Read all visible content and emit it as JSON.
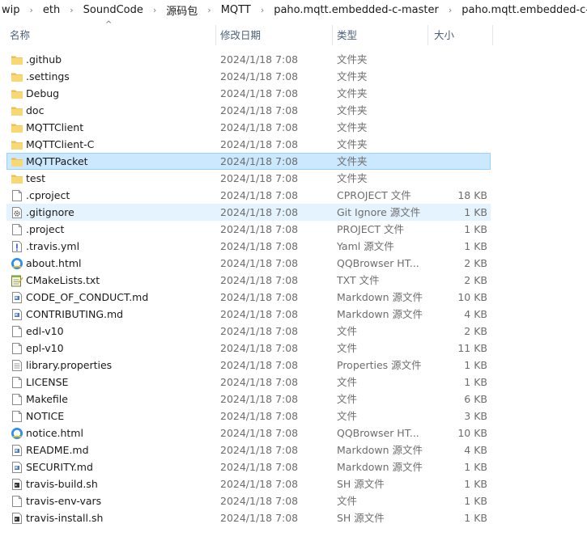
{
  "breadcrumb": [
    "wip",
    "eth",
    "SoundCode",
    "源码包",
    "MQTT",
    "paho.mqtt.embedded-c-master",
    "paho.mqtt.embedded-c-master"
  ],
  "columns": {
    "name": "名称",
    "date": "修改日期",
    "type": "类型",
    "size": "大小"
  },
  "files": [
    {
      "name": ".github",
      "date": "2024/1/18 7:08",
      "type": "文件夹",
      "size": "",
      "icon": "folder-icon"
    },
    {
      "name": ".settings",
      "date": "2024/1/18 7:08",
      "type": "文件夹",
      "size": "",
      "icon": "folder-icon"
    },
    {
      "name": "Debug",
      "date": "2024/1/18 7:08",
      "type": "文件夹",
      "size": "",
      "icon": "folder-icon"
    },
    {
      "name": "doc",
      "date": "2024/1/18 7:08",
      "type": "文件夹",
      "size": "",
      "icon": "folder-icon"
    },
    {
      "name": "MQTTClient",
      "date": "2024/1/18 7:08",
      "type": "文件夹",
      "size": "",
      "icon": "folder-icon"
    },
    {
      "name": "MQTTClient-C",
      "date": "2024/1/18 7:08",
      "type": "文件夹",
      "size": "",
      "icon": "folder-icon"
    },
    {
      "name": "MQTTPacket",
      "date": "2024/1/18 7:08",
      "type": "文件夹",
      "size": "",
      "icon": "folder-icon",
      "selected": true
    },
    {
      "name": "test",
      "date": "2024/1/18 7:08",
      "type": "文件夹",
      "size": "",
      "icon": "folder-icon"
    },
    {
      "name": ".cproject",
      "date": "2024/1/18 7:08",
      "type": "CPROJECT 文件",
      "size": "18 KB",
      "icon": "file-icon"
    },
    {
      "name": ".gitignore",
      "date": "2024/1/18 7:08",
      "type": "Git Ignore 源文件",
      "size": "1 KB",
      "icon": "gear-file-icon",
      "hover": true
    },
    {
      "name": ".project",
      "date": "2024/1/18 7:08",
      "type": "PROJECT 文件",
      "size": "1 KB",
      "icon": "file-icon"
    },
    {
      "name": ".travis.yml",
      "date": "2024/1/18 7:08",
      "type": "Yaml 源文件",
      "size": "1 KB",
      "icon": "exclamation-file-icon"
    },
    {
      "name": "about.html",
      "date": "2024/1/18 7:08",
      "type": "QQBrowser HT...",
      "size": "2 KB",
      "icon": "browser-icon"
    },
    {
      "name": "CMakeLists.txt",
      "date": "2024/1/18 7:08",
      "type": "TXT 文件",
      "size": "2 KB",
      "icon": "notepad-icon"
    },
    {
      "name": "CODE_OF_CONDUCT.md",
      "date": "2024/1/18 7:08",
      "type": "Markdown 源文件",
      "size": "10 KB",
      "icon": "markdown-file-icon"
    },
    {
      "name": "CONTRIBUTING.md",
      "date": "2024/1/18 7:08",
      "type": "Markdown 源文件",
      "size": "4 KB",
      "icon": "markdown-file-icon"
    },
    {
      "name": "edl-v10",
      "date": "2024/1/18 7:08",
      "type": "文件",
      "size": "2 KB",
      "icon": "file-icon"
    },
    {
      "name": "epl-v10",
      "date": "2024/1/18 7:08",
      "type": "文件",
      "size": "11 KB",
      "icon": "file-icon"
    },
    {
      "name": "library.properties",
      "date": "2024/1/18 7:08",
      "type": "Properties 源文件",
      "size": "1 KB",
      "icon": "text-file-icon"
    },
    {
      "name": "LICENSE",
      "date": "2024/1/18 7:08",
      "type": "文件",
      "size": "1 KB",
      "icon": "file-icon"
    },
    {
      "name": "Makefile",
      "date": "2024/1/18 7:08",
      "type": "文件",
      "size": "6 KB",
      "icon": "file-icon"
    },
    {
      "name": "NOTICE",
      "date": "2024/1/18 7:08",
      "type": "文件",
      "size": "3 KB",
      "icon": "file-icon"
    },
    {
      "name": "notice.html",
      "date": "2024/1/18 7:08",
      "type": "QQBrowser HT...",
      "size": "10 KB",
      "icon": "browser-icon"
    },
    {
      "name": "README.md",
      "date": "2024/1/18 7:08",
      "type": "Markdown 源文件",
      "size": "4 KB",
      "icon": "markdown-file-icon"
    },
    {
      "name": "SECURITY.md",
      "date": "2024/1/18 7:08",
      "type": "Markdown 源文件",
      "size": "1 KB",
      "icon": "markdown-file-icon"
    },
    {
      "name": "travis-build.sh",
      "date": "2024/1/18 7:08",
      "type": "SH 源文件",
      "size": "1 KB",
      "icon": "shell-file-icon"
    },
    {
      "name": "travis-env-vars",
      "date": "2024/1/18 7:08",
      "type": "文件",
      "size": "1 KB",
      "icon": "file-icon"
    },
    {
      "name": "travis-install.sh",
      "date": "2024/1/18 7:08",
      "type": "SH 源文件",
      "size": "1 KB",
      "icon": "shell-file-icon"
    }
  ],
  "colors": {
    "folder": "#f8d775",
    "selected_bg": "#cce8ff",
    "selected_border": "#99d1ff",
    "hover_bg": "#e5f3ff",
    "header_text": "#4c607a"
  }
}
